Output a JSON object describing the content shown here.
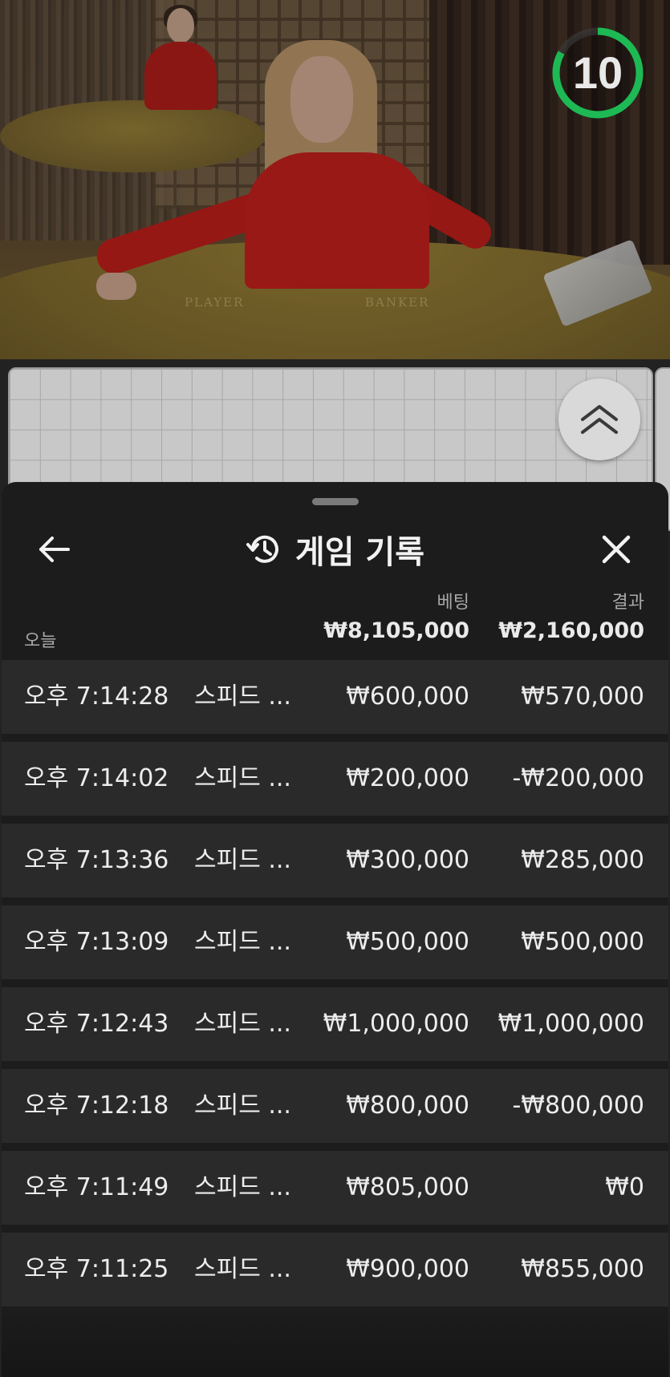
{
  "video": {
    "countdown": "10",
    "countdown_progress": 0.83,
    "table_labels": [
      "PLAYER",
      "BANKER"
    ]
  },
  "sheet": {
    "title": "게임 기록",
    "back_icon": "arrow-left-icon",
    "history_icon": "history-icon",
    "close_icon": "close-icon",
    "expand_icon": "double-chevron-up-icon"
  },
  "summary": {
    "bet_header": "베팅",
    "result_header": "결과",
    "period_label": "오늘",
    "total_bet": "₩8,105,000",
    "total_result": "₩2,160,000"
  },
  "records": [
    {
      "time": "오후 7:14:28",
      "game": "스피드 ...",
      "bet": "₩600,000",
      "result": "₩570,000"
    },
    {
      "time": "오후 7:14:02",
      "game": "스피드 ...",
      "bet": "₩200,000",
      "result": "-₩200,000"
    },
    {
      "time": "오후 7:13:36",
      "game": "스피드 ...",
      "bet": "₩300,000",
      "result": "₩285,000"
    },
    {
      "time": "오후 7:13:09",
      "game": "스피드 ...",
      "bet": "₩500,000",
      "result": "₩500,000"
    },
    {
      "time": "오후 7:12:43",
      "game": "스피드 ...",
      "bet": "₩1,000,000",
      "result": "₩1,000,000"
    },
    {
      "time": "오후 7:12:18",
      "game": "스피드 ...",
      "bet": "₩800,000",
      "result": "-₩800,000"
    },
    {
      "time": "오후 7:11:49",
      "game": "스피드 ...",
      "bet": "₩805,000",
      "result": "₩0"
    },
    {
      "time": "오후 7:11:25",
      "game": "스피드 ...",
      "bet": "₩900,000",
      "result": "₩855,000"
    }
  ],
  "colors": {
    "timer_green": "#1db954",
    "sheet_bg": "#1c1c1c",
    "row_bg": "#2a2a2a"
  }
}
